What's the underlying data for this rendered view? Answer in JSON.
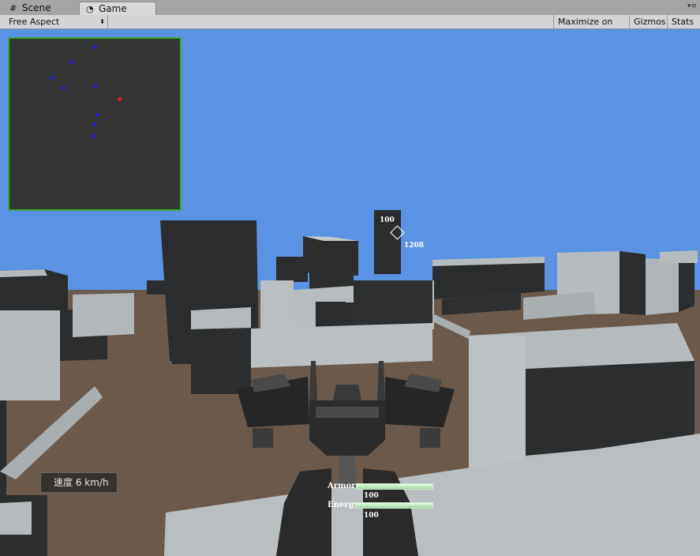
{
  "tabs": [
    {
      "label": "Scene",
      "icon": "grid-icon"
    },
    {
      "label": "Game",
      "icon": "pacman-icon"
    }
  ],
  "toolbar": {
    "aspect": "Free Aspect",
    "maximize": "Maximize on Play",
    "gizmos": "Gizmos",
    "stats": "Stats"
  },
  "hud": {
    "target_armor": "100",
    "target_distance": "1208",
    "speed": "速度 6 km/h",
    "armor_label": "Armor",
    "armor_value": "100",
    "armor_fraction": 1.0,
    "energy_label": "Energy",
    "energy_value": "100",
    "energy_fraction": 1.0
  },
  "minimap": {
    "enemy_count": 8,
    "player_count": 1
  },
  "colors": {
    "sky": "#5a93e3",
    "ground": "#6b5a4c",
    "minimap_border": "#3fa43f",
    "enemy_dot": "#2323c8",
    "player_dot": "#e02020"
  }
}
